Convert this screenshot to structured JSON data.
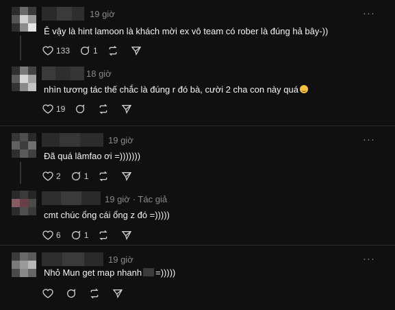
{
  "more_icon_glyph": "···",
  "posts": [
    {
      "time": "19 giờ",
      "text": "Ê vậy là hint lamoon là khách mời ex vô team có rober là đúng hả bây-))",
      "likes": "133",
      "comments": "1",
      "avatar_colors": [
        "#2b2b2b",
        "#6a6a6a",
        "#3a3a3a",
        "#555",
        "#d0d0d0",
        "#9a9a9a",
        "#2f2f2f",
        "#8c8c8c",
        "#e6e6e6"
      ]
    },
    {
      "time": "18 giờ",
      "text": "nhìn tương tác thế chắc là đúng r đó bà, cười 2 cha con này quá",
      "has_emoji": true,
      "likes": "19",
      "comments": "",
      "avatar_colors": [
        "#2f2f2f",
        "#7a7a7a",
        "#444",
        "#5a5a5a",
        "#d6d6d6",
        "#a0a0a0",
        "#333",
        "#8a8a8a",
        "#c4c4c4"
      ]
    },
    {
      "time": "19 giờ",
      "text": "Đã quá lâmfao ơi =)))))))",
      "likes": "2",
      "comments": "1",
      "avatar_colors": [
        "#363636",
        "#4e4e4e",
        "#2a2a2a",
        "#606060",
        "#3c3c3c",
        "#707070",
        "#2e2e2e",
        "#5a5a5a",
        "#404040"
      ]
    },
    {
      "time": "19 giờ",
      "tag": "· Tác giả",
      "text": "cmt chúc ổng cái ổng z đó =)))))",
      "likes": "6",
      "comments": "1",
      "avatar_colors": [
        "#2a2a2a",
        "#3a3a3a",
        "#262626",
        "#8a5a62",
        "#6a4048",
        "#4a4a4a",
        "#2c2c2c",
        "#505050",
        "#3a3a3a"
      ]
    },
    {
      "time": "19 giờ",
      "text_before": "Nhỏ Mun get map nhanh",
      "text_after": "=)))))",
      "likes": "",
      "comments": "",
      "avatar_colors": [
        "#3a3a3a",
        "#6a6a6a",
        "#5a5a5a",
        "#7a7a7a",
        "#9a9a9a",
        "#b8b8b8",
        "#4a4a4a",
        "#8a8a8a",
        "#666"
      ]
    }
  ]
}
